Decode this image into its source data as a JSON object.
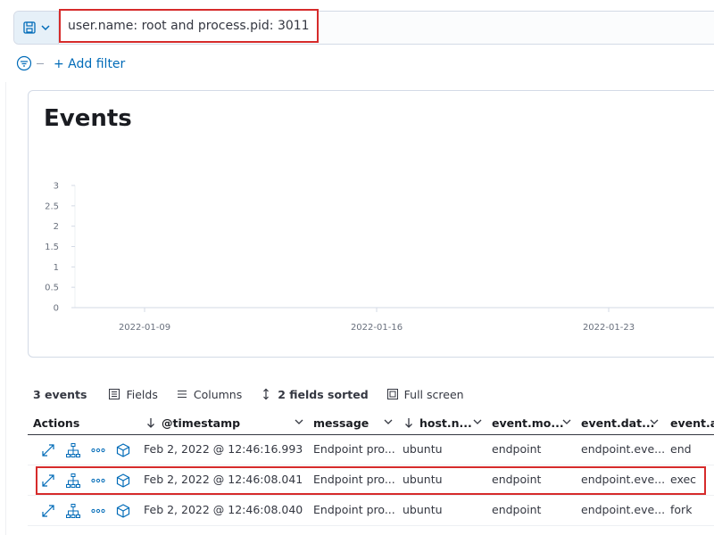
{
  "query": {
    "text": "user.name: root and process.pid: 3011"
  },
  "filters": {
    "add_label": "+ Add filter"
  },
  "panel": {
    "title": "Events",
    "chart_data": {
      "type": "bar",
      "x_ticks": [
        "2022-01-09",
        "2022-01-16",
        "2022-01-23"
      ],
      "y_ticks": [
        "3",
        "2.5",
        "2",
        "1.5",
        "1",
        "0.5",
        "0"
      ],
      "ylim": [
        0,
        3
      ],
      "series": []
    }
  },
  "toolbar": {
    "count": "3 events",
    "fields_label": "Fields",
    "columns_label": "Columns",
    "sorted_label": "2 fields sorted",
    "fullscreen_label": "Full screen"
  },
  "table": {
    "columns": [
      "Actions",
      "@timestamp",
      "message",
      "host.n...",
      "event.mo...",
      "event.dat...",
      "event.ac"
    ],
    "rows": [
      {
        "timestamp": "Feb 2, 2022 @ 12:46:16.993",
        "message": "Endpoint pro...",
        "host": "ubuntu",
        "module": "endpoint",
        "dataset": "endpoint.eve...",
        "action": "end"
      },
      {
        "timestamp": "Feb 2, 2022 @ 12:46:08.041",
        "message": "Endpoint pro...",
        "host": "ubuntu",
        "module": "endpoint",
        "dataset": "endpoint.eve...",
        "action": "exec"
      },
      {
        "timestamp": "Feb 2, 2022 @ 12:46:08.040",
        "message": "Endpoint pro...",
        "host": "ubuntu",
        "module": "endpoint",
        "dataset": "endpoint.eve...",
        "action": "fork"
      }
    ]
  },
  "colors": {
    "accent": "#006bb8",
    "highlight": "#d62b2b"
  }
}
